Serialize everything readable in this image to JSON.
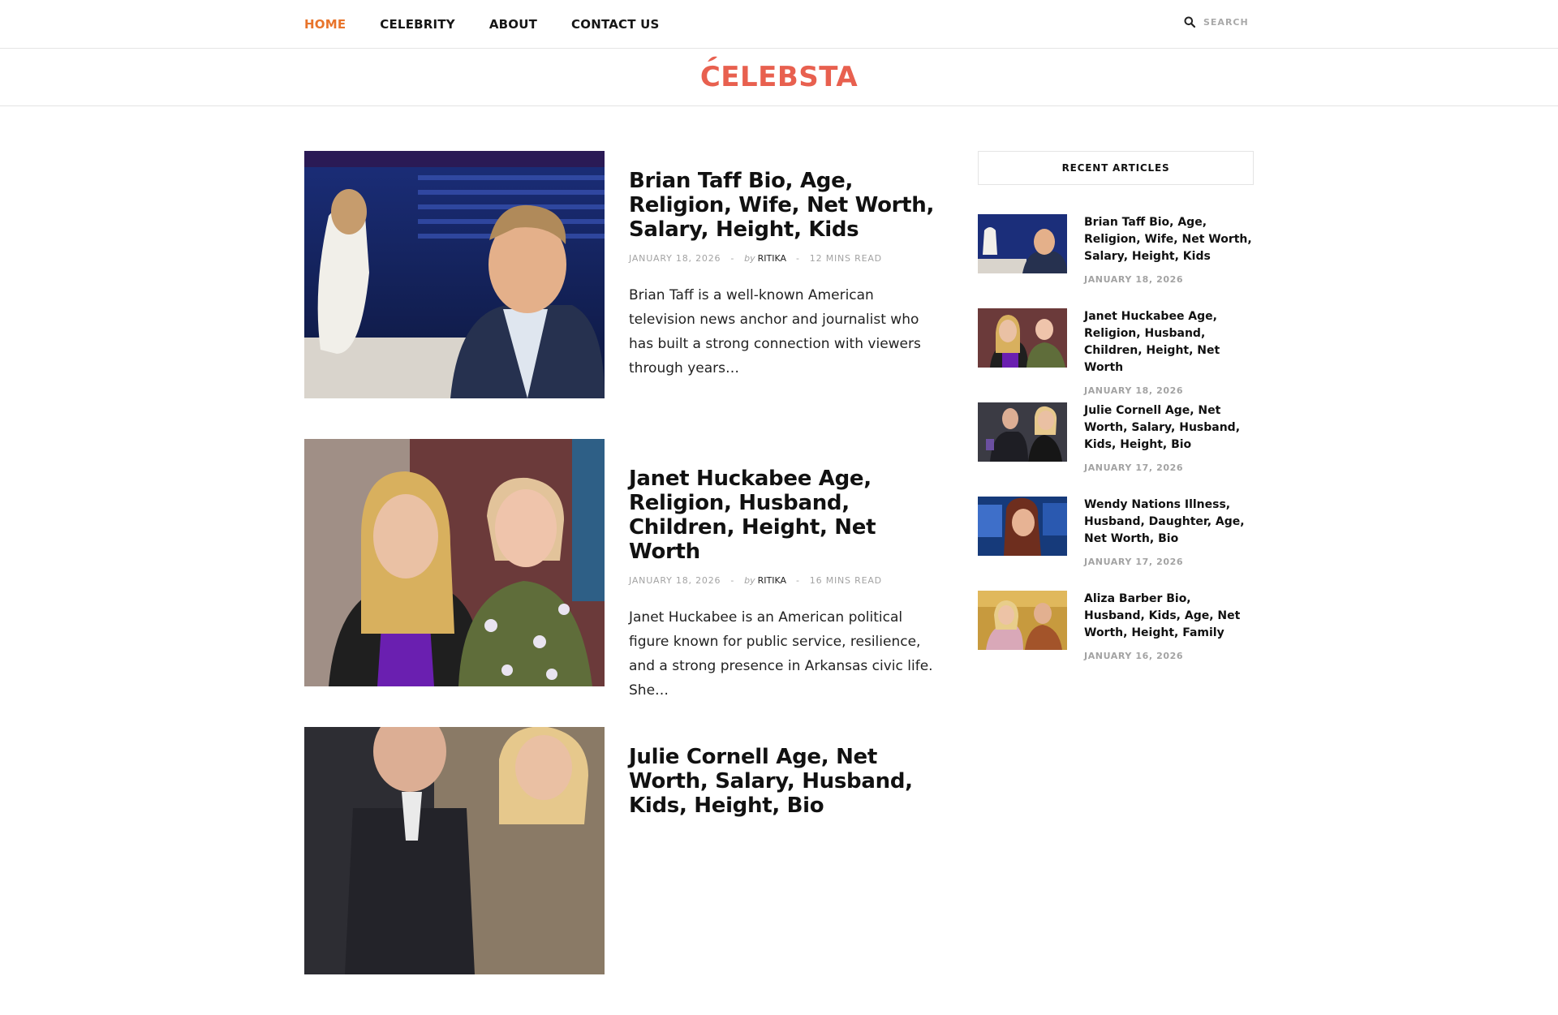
{
  "nav": {
    "items": [
      {
        "label": "HOME",
        "active": true
      },
      {
        "label": "CELEBRITY"
      },
      {
        "label": "ABOUT"
      },
      {
        "label": "CONTACT US"
      }
    ],
    "search_placeholder": "SEARCH",
    "search_icon": "search-icon"
  },
  "site": {
    "logo_text": "CELEBSTA",
    "accent_color": "#e8742b",
    "logo_color": "#e8604f"
  },
  "posts": [
    {
      "title": "Brian Taff Bio, Age, Religion, Wife, Net Worth, Salary, Height, Kids",
      "date": "JANUARY 18, 2026",
      "by": "by",
      "author": "RITIKA",
      "read_time": "12 MINS READ",
      "excerpt": "Brian Taff is a well-known American television news anchor and journalist who has built a strong connection with viewers through years…"
    },
    {
      "title": "Janet Huckabee Age, Religion, Husband, Children, Height, Net Worth",
      "date": "JANUARY 18, 2026",
      "by": "by",
      "author": "RITIKA",
      "read_time": "16 MINS READ",
      "excerpt": "Janet Huckabee is an American political figure known for public service, resilience, and a strong presence in Arkansas civic life. She…"
    },
    {
      "title": "Julie Cornell Age, Net Worth, Salary, Husband, Kids, Height, Bio"
    }
  ],
  "sidebar": {
    "widget_title": "RECENT ARTICLES",
    "recent": [
      {
        "title": "Brian Taff Bio, Age, Religion, Wife, Net Worth, Salary, Height, Kids",
        "date": "JANUARY 18, 2026"
      },
      {
        "title": "Janet Huckabee Age, Religion, Husband, Children, Height, Net Worth",
        "date": "JANUARY 18, 2026"
      },
      {
        "title": "Julie Cornell Age, Net Worth, Salary, Husband, Kids, Height, Bio",
        "date": "JANUARY 17, 2026"
      },
      {
        "title": "Wendy Nations Illness, Husband, Daughter, Age, Net Worth, Bio",
        "date": "JANUARY 17, 2026"
      },
      {
        "title": "Aliza Barber Bio, Husband, Kids, Age, Net Worth, Height, Family",
        "date": "JANUARY 16, 2026"
      }
    ]
  },
  "separator": "-"
}
